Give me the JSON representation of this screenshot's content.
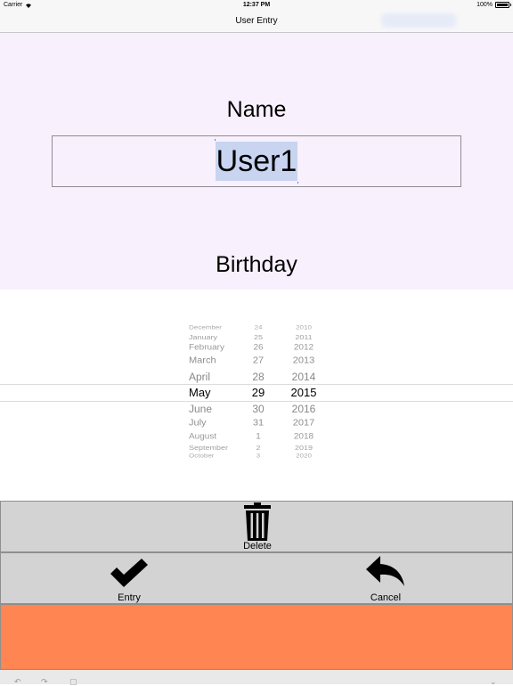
{
  "status_bar": {
    "carrier": "Carrier",
    "time": "12:37 PM",
    "battery": "100%",
    "battery_level": 1.0
  },
  "nav_bar": {
    "title": "User Entry"
  },
  "form": {
    "name_label": "Name",
    "name_value": "User1",
    "birthday_label": "Birthday"
  },
  "date_picker": {
    "selected": {
      "month": "May",
      "day": "29",
      "year": "2015"
    },
    "rows": [
      {
        "month": "December",
        "day": "24",
        "year": "2010"
      },
      {
        "month": "January",
        "day": "25",
        "year": "2011"
      },
      {
        "month": "February",
        "day": "26",
        "year": "2012"
      },
      {
        "month": "March",
        "day": "27",
        "year": "2013"
      },
      {
        "month": "April",
        "day": "28",
        "year": "2014"
      },
      {
        "month": "May",
        "day": "29",
        "year": "2015"
      },
      {
        "month": "June",
        "day": "30",
        "year": "2016"
      },
      {
        "month": "July",
        "day": "31",
        "year": "2017"
      },
      {
        "month": "August",
        "day": "1",
        "year": "2018"
      },
      {
        "month": "September",
        "day": "2",
        "year": "2019"
      },
      {
        "month": "October",
        "day": "3",
        "year": "2020"
      }
    ]
  },
  "buttons": {
    "delete_label": "Delete",
    "entry_label": "Entry",
    "cancel_label": "Cancel"
  },
  "colors": {
    "form_bg": "#f8f0fd",
    "button_bg": "#d3d3d3",
    "accent": "#ff8552",
    "selection": "#c8d4f0"
  }
}
